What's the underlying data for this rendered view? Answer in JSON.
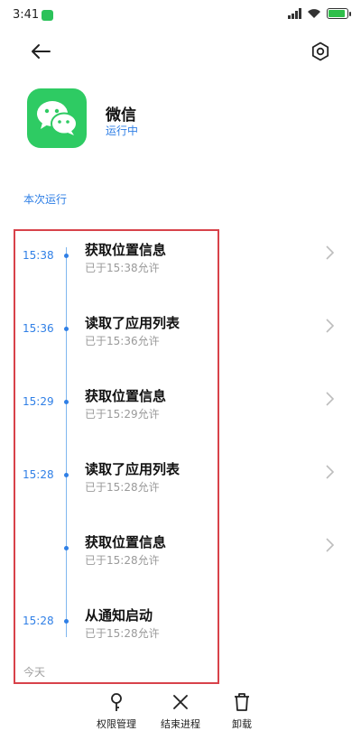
{
  "status_bar": {
    "time": "3:41"
  },
  "app": {
    "name": "微信",
    "status": "运行中"
  },
  "section_title": "本次运行",
  "timeline": [
    {
      "time": "15:38",
      "title": "获取位置信息",
      "subtitle": "已于15:38允许"
    },
    {
      "time": "15:36",
      "title": "读取了应用列表",
      "subtitle": "已于15:36允许"
    },
    {
      "time": "15:29",
      "title": "获取位置信息",
      "subtitle": "已于15:29允许"
    },
    {
      "time": "15:28",
      "title": "读取了应用列表",
      "subtitle": "已于15:28允许"
    },
    {
      "time": "",
      "title": "获取位置信息",
      "subtitle": "已于15:28允许"
    },
    {
      "time": "15:28",
      "title": "从通知启动",
      "subtitle": "已于15:28允许"
    }
  ],
  "today_label": "今天",
  "bottom_actions": {
    "permissions": "权限管理",
    "end_process": "结束进程",
    "uninstall": "卸载"
  },
  "colors": {
    "accent": "#2f7fe6",
    "highlight_box": "#d8424a",
    "app_green": "#2ecb63"
  }
}
